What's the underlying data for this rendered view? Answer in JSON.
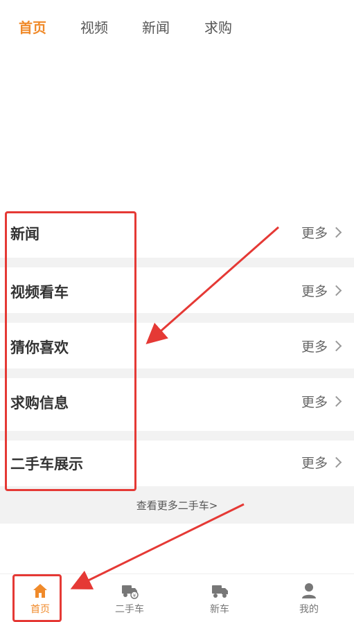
{
  "top_tabs": [
    {
      "label": "首页",
      "active": true
    },
    {
      "label": "视频",
      "active": false
    },
    {
      "label": "新闻",
      "active": false
    },
    {
      "label": "求购",
      "active": false
    }
  ],
  "sections": [
    {
      "title": "新闻",
      "more": "更多"
    },
    {
      "title": "视频看车",
      "more": "更多"
    },
    {
      "title": "猜你喜欢",
      "more": "更多"
    },
    {
      "title": "求购信息",
      "more": "更多"
    },
    {
      "title": "二手车展示",
      "more": "更多"
    }
  ],
  "see_more_label": "查看更多二手车>",
  "bottom_nav": [
    {
      "label": "首页",
      "icon": "home-icon",
      "active": true
    },
    {
      "label": "二手车",
      "icon": "used-truck-icon",
      "active": false
    },
    {
      "label": "新车",
      "icon": "truck-icon",
      "active": false
    },
    {
      "label": "我的",
      "icon": "user-icon",
      "active": false
    }
  ],
  "colors": {
    "accent": "#f08a2a",
    "annotation": "#e53935"
  }
}
